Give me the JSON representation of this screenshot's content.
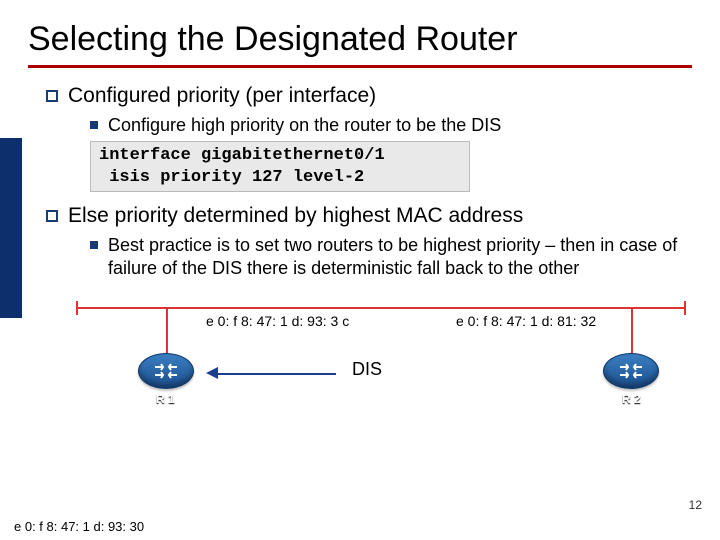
{
  "title": "Selecting the Designated Router",
  "bullets": {
    "b1": "Configured priority (per interface)",
    "b1_s1": "Configure high priority on the router to be the DIS",
    "code": "interface gigabitethernet0/1\n isis priority 127 level-2",
    "b2": "Else priority determined by highest MAC address",
    "b2_s1": "Best practice is to set two routers to be highest priority – then in case of failure of the DIS there is deterministic fall back to the other"
  },
  "diagram": {
    "ifc_left": "e 0: f 8: 47: 1 d: 93: 3 c",
    "ifc_right": "e 0: f 8: 47: 1 d: 81: 32",
    "r1_label": "R 1",
    "r2_label": "R 2",
    "dis_label": "DIS"
  },
  "footer_ifc": "e 0: f 8: 47: 1 d: 93: 30",
  "page_number": "12"
}
